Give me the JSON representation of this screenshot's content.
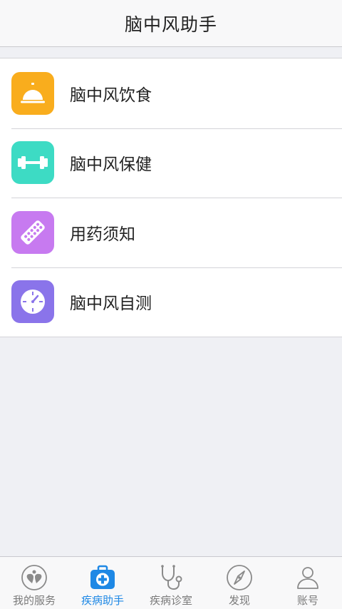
{
  "header": {
    "title": "脑中风助手"
  },
  "menu": {
    "items": [
      {
        "label": "脑中风饮食",
        "icon": "service-bell-icon",
        "color": "#f9ad1d"
      },
      {
        "label": "脑中风保健",
        "icon": "dumbbell-icon",
        "color": "#3ddbc4"
      },
      {
        "label": "用药须知",
        "icon": "pill-strip-icon",
        "color": "#c77af0"
      },
      {
        "label": "脑中风自测",
        "icon": "stopwatch-icon",
        "color": "#8a74ea"
      }
    ]
  },
  "tabbar": {
    "active_color": "#1e88e5",
    "items": [
      {
        "label": "我的服务",
        "icon": "hearts-icon",
        "active": false
      },
      {
        "label": "疾病助手",
        "icon": "medical-bag-icon",
        "active": true
      },
      {
        "label": "疾病诊室",
        "icon": "stethoscope-icon",
        "active": false
      },
      {
        "label": "发现",
        "icon": "compass-icon",
        "active": false
      },
      {
        "label": "账号",
        "icon": "user-icon",
        "active": false
      }
    ]
  }
}
